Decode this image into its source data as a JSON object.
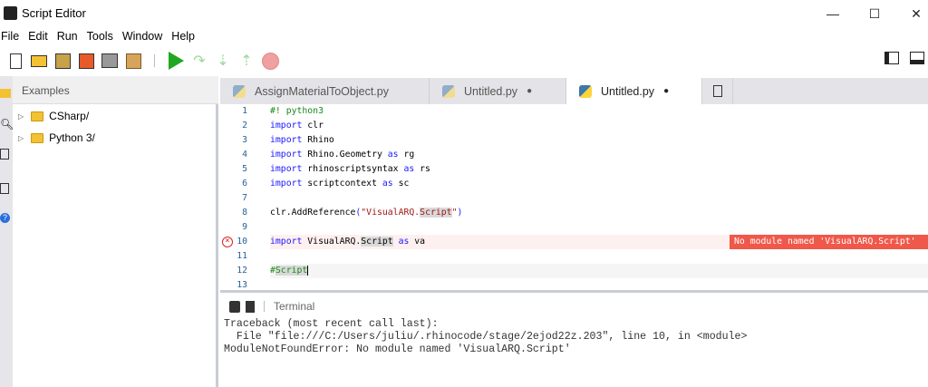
{
  "window": {
    "title": "Script Editor",
    "controls": [
      "minimize",
      "maximize",
      "close"
    ]
  },
  "menu": [
    "File",
    "Edit",
    "Run",
    "Tools",
    "Window",
    "Help"
  ],
  "toolbar": [
    "new-file",
    "open-folder",
    "save",
    "save-as",
    "save-all",
    "package",
    "run",
    "step-over",
    "step-into",
    "step-out",
    "stop"
  ],
  "sidebar": {
    "header": "Examples",
    "items": [
      {
        "label": "CSharp/"
      },
      {
        "label": "Python 3/"
      }
    ]
  },
  "tabs": [
    {
      "label": "AssignMaterialToObject.py",
      "dirty": ""
    },
    {
      "label": "Untitled.py",
      "dirty": "●"
    },
    {
      "label": "Untitled.py",
      "dirty": "●",
      "active": true
    }
  ],
  "editor": {
    "lines": [
      {
        "n": "1"
      },
      {
        "n": "2"
      },
      {
        "n": "3"
      },
      {
        "n": "4"
      },
      {
        "n": "5"
      },
      {
        "n": "6"
      },
      {
        "n": "7"
      },
      {
        "n": "8"
      },
      {
        "n": "9"
      },
      {
        "n": "10"
      },
      {
        "n": "11"
      },
      {
        "n": "12"
      },
      {
        "n": "13"
      }
    ],
    "error_message": "No module named 'VisualARQ.Script'"
  },
  "terminal": {
    "title": "Terminal",
    "output": "Traceback (most recent call last):\n  File \"file:///C:/Users/juliu/.rhinocode/stage/2ejod22z.203\", line 10, in <module>\nModuleNotFoundError: No module named 'VisualARQ.Script'"
  },
  "colors": {
    "error": "#f0584a",
    "keyword": "#1a1aff",
    "comment": "#1a8a1a",
    "string": "#a31515"
  }
}
